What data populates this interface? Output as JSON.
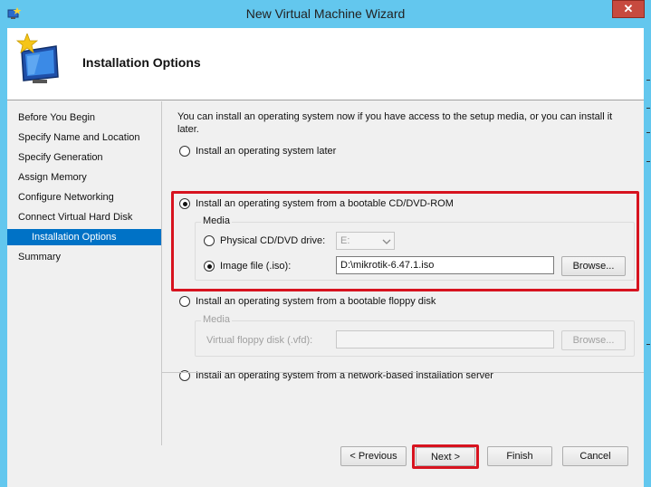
{
  "window": {
    "title": "New Virtual Machine Wizard",
    "close_label": "✕"
  },
  "header": {
    "title": "Installation Options"
  },
  "nav": {
    "items": [
      {
        "label": "Before You Begin",
        "selected": false
      },
      {
        "label": "Specify Name and Location",
        "selected": false
      },
      {
        "label": "Specify Generation",
        "selected": false
      },
      {
        "label": "Assign Memory",
        "selected": false
      },
      {
        "label": "Configure Networking",
        "selected": false
      },
      {
        "label": "Connect Virtual Hard Disk",
        "selected": false
      },
      {
        "label": "Installation Options",
        "selected": true
      },
      {
        "label": "Summary",
        "selected": false
      }
    ]
  },
  "content": {
    "intro_line1": "You can install an operating system now if you have access to the setup media, or you can install it",
    "intro_line2": "later.",
    "option_later": "Install an operating system later",
    "option_cd": "Install an operating system from a bootable CD/DVD-ROM",
    "cd_group_title": "Media",
    "physical_drive_label": "Physical CD/DVD drive:",
    "physical_drive_value": "E:",
    "image_file_label": "Image file (.iso):",
    "image_file_value": "D:\\mikrotik-6.47.1.iso",
    "browse_label": "Browse...",
    "option_floppy": "Install an operating system from a bootable floppy disk",
    "floppy_group_title": "Media",
    "floppy_label": "Virtual floppy disk (.vfd):",
    "floppy_value": "",
    "floppy_browse_label": "Browse...",
    "option_network": "Install an operating system from a network-based installation server",
    "selected_option": "cd",
    "selected_media": "image"
  },
  "footer": {
    "previous_label": "< Previous",
    "next_label": "Next >",
    "finish_label": "Finish",
    "cancel_label": "Cancel"
  },
  "colors": {
    "title_bar": "#63c7ee",
    "selection": "#0072c6",
    "highlight": "#d7131f"
  },
  "icons": {
    "title": "hyperv-window-icon",
    "header": "monitor-star-icon",
    "close": "close-icon"
  }
}
